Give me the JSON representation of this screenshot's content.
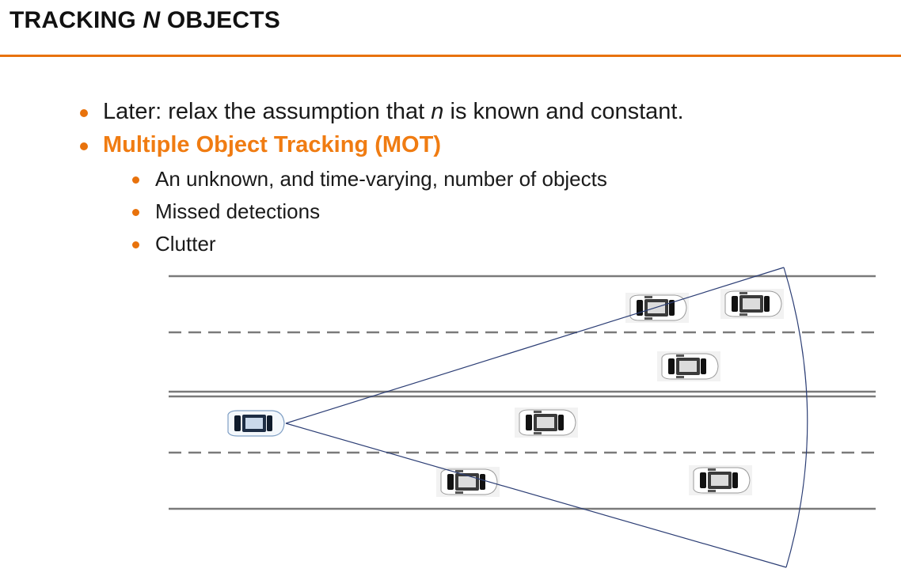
{
  "slide": {
    "title_before": "TRACKING ",
    "title_italic": "N",
    "title_after": " OBJECTS",
    "accent_color": "#e8720c"
  },
  "bullets": [
    {
      "before": "Later: relax the assumption that ",
      "italic": "n",
      "after": " is known and constant."
    },
    {
      "text": "Multiple Object Tracking (MOT)",
      "highlight": true
    }
  ],
  "sub_bullets": [
    "An unknown, and time-varying, number of objects",
    "Missed detections",
    "Clutter"
  ],
  "scene": {
    "road_line_color": "#7a7a7a",
    "sensor_fov_color": "#2c3e75",
    "ego_car_icon": "ego-car-icon",
    "other_car_icon": "car-icon"
  }
}
